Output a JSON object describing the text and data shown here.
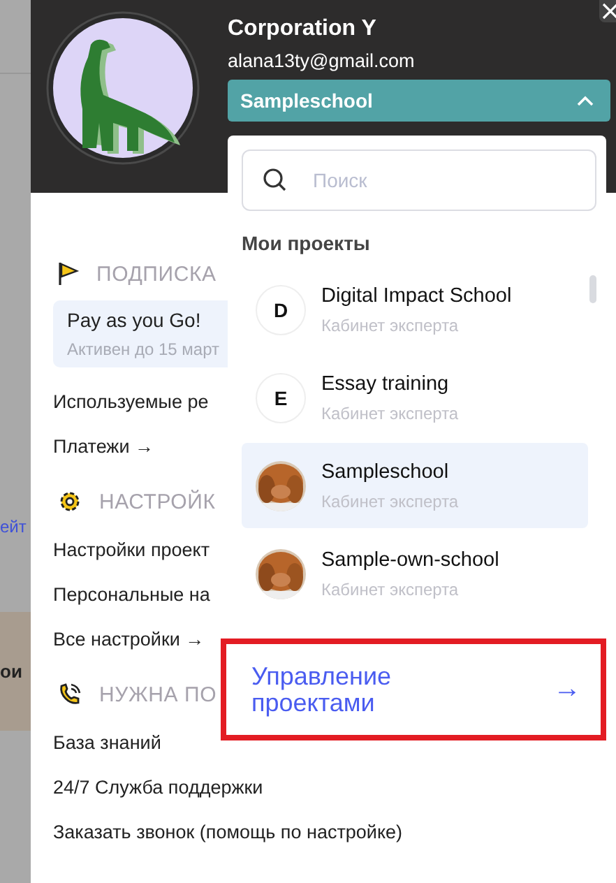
{
  "background_page": {
    "link_fragment": "ейт",
    "heading_fragment": "ои"
  },
  "profile": {
    "name": "Corporation Y",
    "email": "alana13ty@gmail.com",
    "project_select": {
      "value": "Sampleschool",
      "expanded": true
    }
  },
  "sections": [
    {
      "kind": "subscription",
      "title": "ПОДПИСКА",
      "card": {
        "plan": "Pay as you Go!",
        "status": "Активен до 15 март"
      },
      "items": [
        "Используемые ре",
        "Платежи →"
      ]
    },
    {
      "kind": "settings",
      "title": "НАСТРОЙК",
      "items": [
        "Настройки проект",
        "Персональные на",
        "Все настройки →"
      ]
    },
    {
      "kind": "help",
      "title": "НУЖНА ПО",
      "items": [
        "База знаний",
        "24/7 Служба поддержки",
        "Заказать звонок (помощь по настройке)"
      ]
    }
  ],
  "project_menu": {
    "search": {
      "placeholder": "Поиск"
    },
    "heading": "Мои проекты",
    "projects": [
      {
        "name": "Digital Impact School",
        "role": "Кабинет эксперта",
        "avatar": {
          "kind": "letter",
          "letter": "D"
        },
        "selected": false
      },
      {
        "name": "Essay training",
        "role": "Кабинет эксперта",
        "avatar": {
          "kind": "letter",
          "letter": "E"
        },
        "selected": false
      },
      {
        "name": "Sampleschool",
        "role": "Кабинет эксперта",
        "selected": true
      },
      {
        "name": "Sample-own-school",
        "role": "Кабинет эксперта",
        "selected": false
      }
    ],
    "manage_link": {
      "label": "Управление проектами",
      "arrow": "→",
      "highlighted": true
    }
  }
}
